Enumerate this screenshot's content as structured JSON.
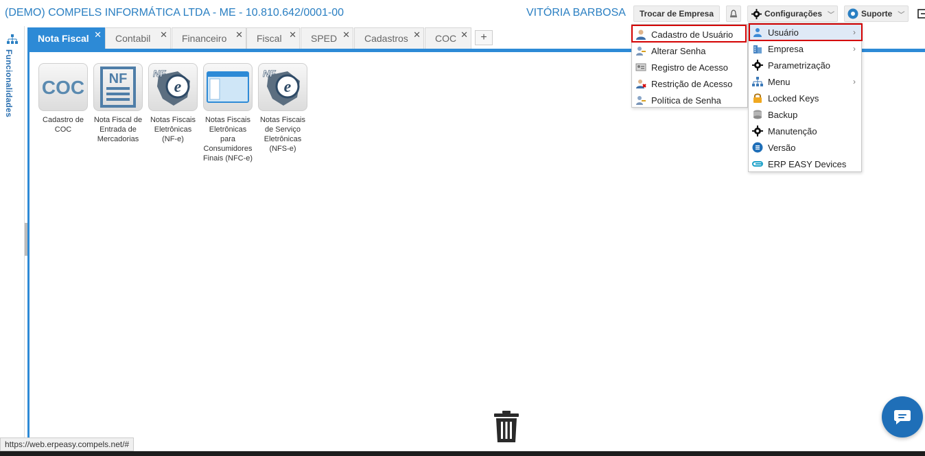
{
  "header": {
    "company": "(DEMO) COMPELS INFORMÁTICA LTDA - ME - 10.810.642/0001-00",
    "user": "VITÓRIA BARBOSA",
    "trocar_label": "Trocar de Empresa",
    "config_label": "Configurações",
    "suporte_label": "Suporte"
  },
  "sidebar": {
    "label": "Funcionalidades"
  },
  "tabs": [
    {
      "label": "Nota Fiscal",
      "active": true
    },
    {
      "label": "Contabil"
    },
    {
      "label": "Financeiro"
    },
    {
      "label": "Fiscal"
    },
    {
      "label": "SPED"
    },
    {
      "label": "Cadastros"
    },
    {
      "label": "COC"
    }
  ],
  "tab_add": "+",
  "tiles": [
    {
      "label": "Cadastro de COC",
      "icon": "coc-icon"
    },
    {
      "label": "Nota Fiscal de Entrada de Mercadorias",
      "icon": "nf-document-icon"
    },
    {
      "label": "Notas Fiscais Eletrônicas (NF-e)",
      "icon": "nfe-icon"
    },
    {
      "label": "Notas Fiscais Eletrônicas para Consumidores Finais (NFC-e)",
      "icon": "window-icon"
    },
    {
      "label": "Notas Fiscais de Serviço Eletrônicas (NFS-e)",
      "icon": "nfe-icon"
    }
  ],
  "user_menu": [
    {
      "label": "Cadastro de Usuário",
      "icon": "user-icon",
      "highlighted": true
    },
    {
      "label": "Alterar Senha",
      "icon": "key-user-icon"
    },
    {
      "label": "Registro de Acesso",
      "icon": "id-card-icon"
    },
    {
      "label": "Restrição de Acesso",
      "icon": "user-block-icon"
    },
    {
      "label": "Política de Senha",
      "icon": "key-user-icon"
    }
  ],
  "config_menu": [
    {
      "label": "Usuário",
      "icon": "users-icon",
      "submenu": true,
      "selected": true
    },
    {
      "label": "Empresa",
      "icon": "building-icon",
      "submenu": true
    },
    {
      "label": "Parametrização",
      "icon": "gear-icon"
    },
    {
      "label": "Menu",
      "icon": "sitemap-icon",
      "submenu": true
    },
    {
      "label": "Locked Keys",
      "icon": "lock-icon"
    },
    {
      "label": "Backup",
      "icon": "backup-icon"
    },
    {
      "label": "Manutenção",
      "icon": "gear-icon"
    },
    {
      "label": "Versão",
      "icon": "list-icon"
    },
    {
      "label": "ERP EASY Devices",
      "icon": "devices-icon"
    }
  ],
  "status_url": "https://web.erpeasy.compels.net/#",
  "colors": {
    "brand": "#2a7fc2",
    "tab_active": "#2d8ad6",
    "highlight": "#d40000",
    "chat": "#1f6fb8"
  }
}
